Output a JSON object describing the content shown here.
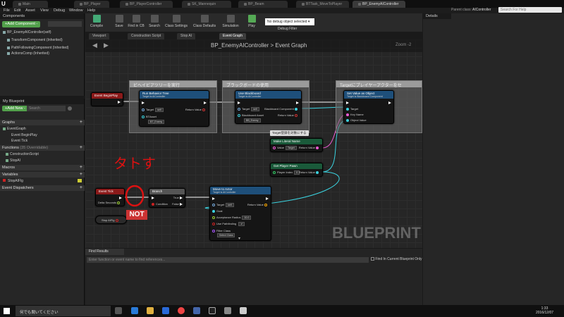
{
  "tabs": [
    {
      "label": "Main"
    },
    {
      "label": "BP_Player"
    },
    {
      "label": "BP_PlayerController"
    },
    {
      "label": "SK_Mannequin"
    },
    {
      "label": "BP_Beam"
    },
    {
      "label": "BTTask_MoveToPlayer"
    },
    {
      "label": "BP_EnemyAIController"
    }
  ],
  "menu": [
    "File",
    "Edit",
    "Asset",
    "View",
    "Debug",
    "Window",
    "Help"
  ],
  "header_right": {
    "parent_class_label": "Parent class:",
    "parent_class_value": "AIController",
    "search_help": "Search For Help"
  },
  "components": {
    "title": "Components",
    "add_button": "+Add Component -",
    "root": "BP_EnemyAIController(self)",
    "items": [
      "TransformComponent (Inherited)",
      "PathFollowingComponent (Inherited)",
      "ActionsComp (Inherited)"
    ]
  },
  "my_blueprint": {
    "title": "My Blueprint",
    "add_new": "+Add New -",
    "search_placeholder": "Search",
    "graphs_label": "Graphs",
    "event_graph": "EventGraph",
    "events": [
      "Event BeginPlay",
      "Event Tick"
    ],
    "functions_label": "Functions",
    "functions_note": "(35 Overridable)",
    "functions": [
      "ConstructionScript",
      "StopAI"
    ],
    "macros_label": "Macros",
    "variables_label": "Variables",
    "variables": [
      "StopAIFlg"
    ],
    "dispatchers_label": "Event Dispatchers"
  },
  "toolbar": {
    "buttons": [
      "Compile",
      "Save",
      "Find in CB",
      "Search",
      "Class Settings",
      "Class Defaults",
      "Simulation",
      "Play"
    ],
    "debug_select": "No debug object selected",
    "debug_label": "Debug Filter"
  },
  "graph_tabs": [
    "Viewport",
    "Construction Script",
    "Stop AI",
    "Event Graph"
  ],
  "graph": {
    "breadcrumb": "BP_EnemyAIController > Event Graph",
    "zoom": "Zoom -2",
    "watermark": "BLUEPRINT",
    "comments": [
      "ビヘイビアツリーを実行",
      "ブラックボードの使用",
      "Targetにプレイヤーアクターをセ"
    ],
    "nodes": {
      "begin_play": {
        "title": "Event BeginPlay"
      },
      "run_bt": {
        "title": "Run Behavior Tree",
        "sub": "Target is AIController",
        "target": "Target",
        "self": "self",
        "btasset": "BTAsset",
        "btasset_val": "BT_Enemy",
        "return": "Return Value"
      },
      "use_bb": {
        "title": "Use Blackboard",
        "sub": "Target is AIController",
        "target": "Target",
        "self": "self",
        "asset": "Blackboard Asset",
        "asset_val": "BB_Enemy",
        "component": "Blackboard Component",
        "return": "Return Value"
      },
      "set_value": {
        "title": "Set Value as Object",
        "sub": "Target is Blackboard Component",
        "target": "Target",
        "key": "Key Name",
        "object": "Object Value"
      },
      "tooltip": "Target登録を対象にする",
      "make_literal": {
        "title": "Make Literal Name",
        "value": "Value",
        "value_val": "Target",
        "return": "Return Value"
      },
      "get_player_pawn": {
        "title": "Get Player Pawn",
        "index": "Player Index",
        "index_val": "0",
        "return": "Return Value"
      },
      "event_tick": {
        "title": "Event Tick",
        "delta": "Delta Seconds"
      },
      "branch": {
        "title": "Branch",
        "condition": "Condition",
        "true": "True",
        "false": "False"
      },
      "stop_flag": {
        "title": "Stop AIFlg"
      },
      "move_to_actor": {
        "title": "Move to Actor",
        "sub": "Target is AIController",
        "target": "Target",
        "self": "self",
        "goal": "Goal",
        "radius": "Acceptance Radius",
        "radius_val": "10.0",
        "pathfinding": "Use Pathfinding",
        "filter": "Filter Class",
        "filter_val": "Select Class",
        "return": "Return Value"
      }
    },
    "annotations": {
      "handwritten": "タトす",
      "not_label": "NOT"
    }
  },
  "find_results": {
    "tab": "Find Results",
    "placeholder": "Enter function or event name to find references...",
    "checkbox": "Find In Current Blueprint Only"
  },
  "details": {
    "title": "Details"
  },
  "taskbar": {
    "search": "何でも聞いてください",
    "time": "1:33",
    "date": "2016/12/07"
  }
}
